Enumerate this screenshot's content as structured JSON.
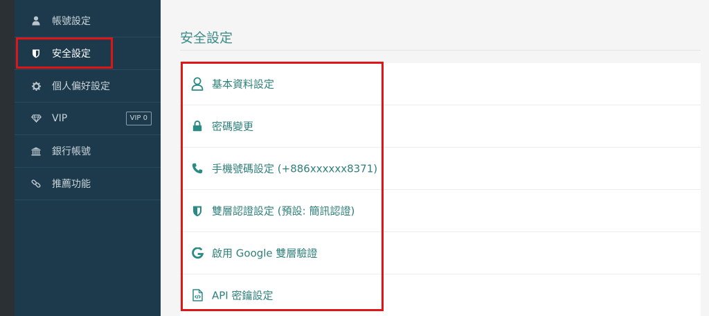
{
  "sidebar": {
    "items": [
      {
        "label": "帳號設定",
        "icon": "user-icon"
      },
      {
        "label": "安全設定",
        "icon": "shield-icon",
        "active": true
      },
      {
        "label": "個人偏好設定",
        "icon": "gear-icon"
      },
      {
        "label": "VIP",
        "icon": "diamond-icon",
        "badge": "VIP 0"
      },
      {
        "label": "銀行帳號",
        "icon": "bank-icon"
      },
      {
        "label": "推薦功能",
        "icon": "link-icon"
      }
    ]
  },
  "main": {
    "title": "安全設定",
    "settings": [
      {
        "label": "基本資料設定",
        "icon": "user-outline-icon"
      },
      {
        "label": "密碼變更",
        "icon": "lock-icon"
      },
      {
        "label": "手機號碼設定 (+886xxxxxx8371)",
        "icon": "phone-icon"
      },
      {
        "label": "雙層認證設定 (預設: 簡訊認證)",
        "icon": "shield-icon"
      },
      {
        "label": "啟用 Google 雙層驗證",
        "icon": "google-icon"
      },
      {
        "label": "API 密鑰設定",
        "icon": "code-file-icon"
      }
    ]
  },
  "colors": {
    "sidebar_bg": "#1d3a4c",
    "accent_teal": "#2e7f7a",
    "highlight_red": "#e01616"
  }
}
